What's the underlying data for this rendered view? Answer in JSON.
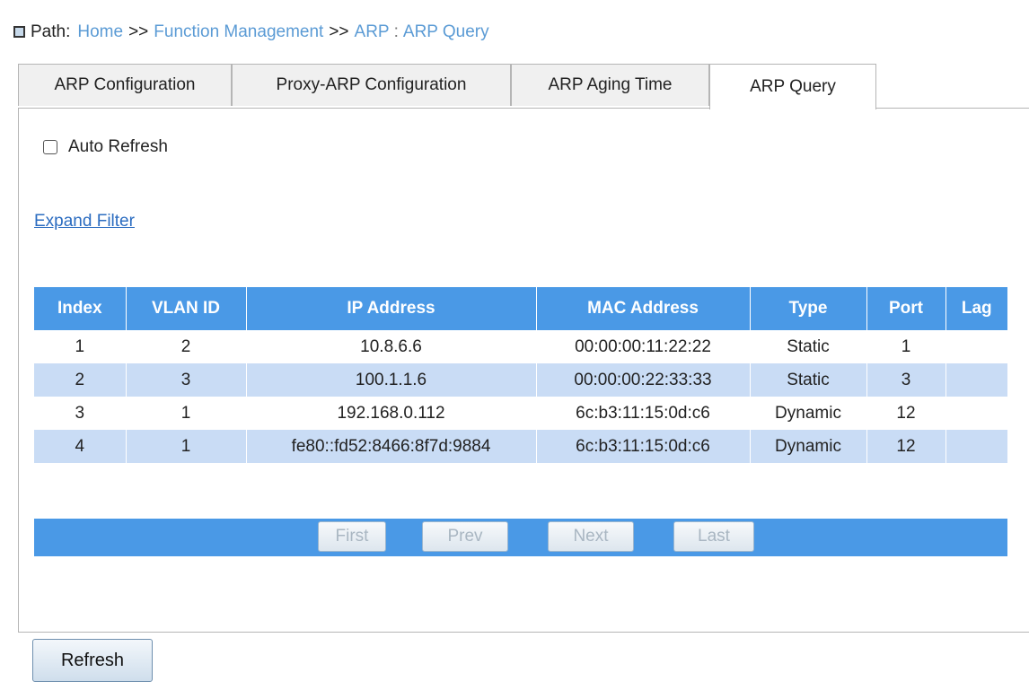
{
  "breadcrumb": {
    "prefix": "Path:",
    "home": "Home",
    "sep1": ">>",
    "function_management": "Function Management",
    "sep2": ">>",
    "arp": "ARP",
    "colon": ":",
    "current": "ARP Query"
  },
  "tabs": [
    {
      "label": "ARP Configuration"
    },
    {
      "label": "Proxy-ARP Configuration"
    },
    {
      "label": "ARP Aging Time"
    },
    {
      "label": "ARP Query",
      "active": true
    }
  ],
  "auto_refresh": {
    "label": "Auto Refresh",
    "checked": false
  },
  "expand_filter": "Expand Filter",
  "table": {
    "headers": [
      "Index",
      "VLAN ID",
      "IP Address",
      "MAC Address",
      "Type",
      "Port",
      "Lag"
    ],
    "rows": [
      [
        "1",
        "2",
        "10.8.6.6",
        "00:00:00:11:22:22",
        "Static",
        "1",
        ""
      ],
      [
        "2",
        "3",
        "100.1.1.6",
        "00:00:00:22:33:33",
        "Static",
        "3",
        ""
      ],
      [
        "3",
        "1",
        "192.168.0.112",
        "6c:b3:11:15:0d:c6",
        "Dynamic",
        "12",
        ""
      ],
      [
        "4",
        "1",
        "fe80::fd52:8466:8f7d:9884",
        "6c:b3:11:15:0d:c6",
        "Dynamic",
        "12",
        ""
      ]
    ]
  },
  "pager": {
    "first": "First",
    "prev": "Prev",
    "next": "Next",
    "last": "Last"
  },
  "refresh_label": "Refresh",
  "colors": {
    "header_blue": "#4a99e6",
    "stripe_blue": "#c9dcf5",
    "link_blue": "#5b9bd5"
  }
}
